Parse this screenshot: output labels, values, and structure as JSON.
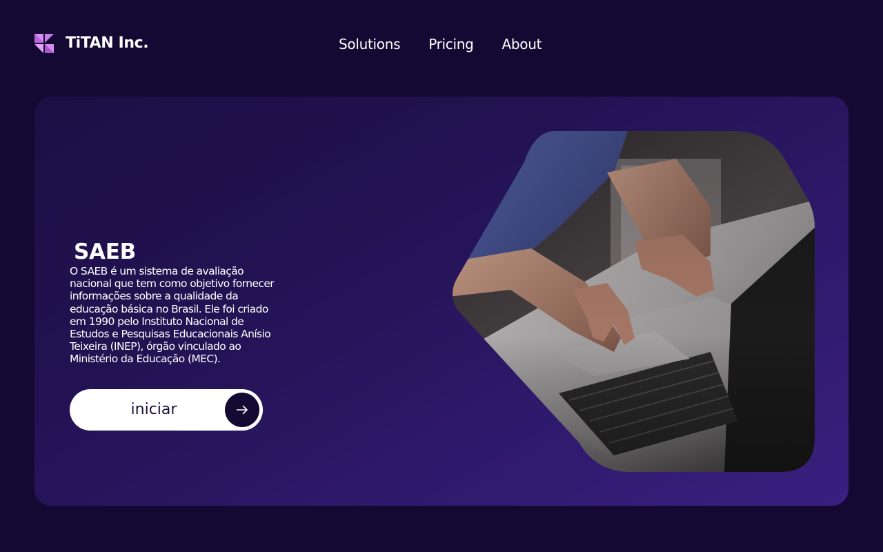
{
  "brand": {
    "name": "TiTAN Inc.",
    "logo_icon": "triangle-logo-icon",
    "logo_color": "#d88cf2"
  },
  "nav": {
    "items": [
      {
        "label": "Solutions"
      },
      {
        "label": "Pricing"
      },
      {
        "label": "About"
      }
    ]
  },
  "hero": {
    "title": "SAEB",
    "description": "O SAEB é um sistema de avaliação nacional que tem como objetivo fornecer informações sobre a qualidade da educação básica no Brasil. Ele foi criado em 1990 pelo Instituto Nacional de Estudos e Pesquisas Educacionais Anísio Teixeira (INEP), órgão vinculado ao Ministério da Educação (MEC).",
    "cta_label": "iniciar",
    "cta_icon": "arrow-right-icon",
    "image_icon": "laptop-typing-photo"
  },
  "colors": {
    "background": "#130932",
    "card_gradient_start": "#1c0f45",
    "card_gradient_end": "#3a1f80",
    "button_background": "#ffffff",
    "button_text": "#1a0f3a"
  }
}
